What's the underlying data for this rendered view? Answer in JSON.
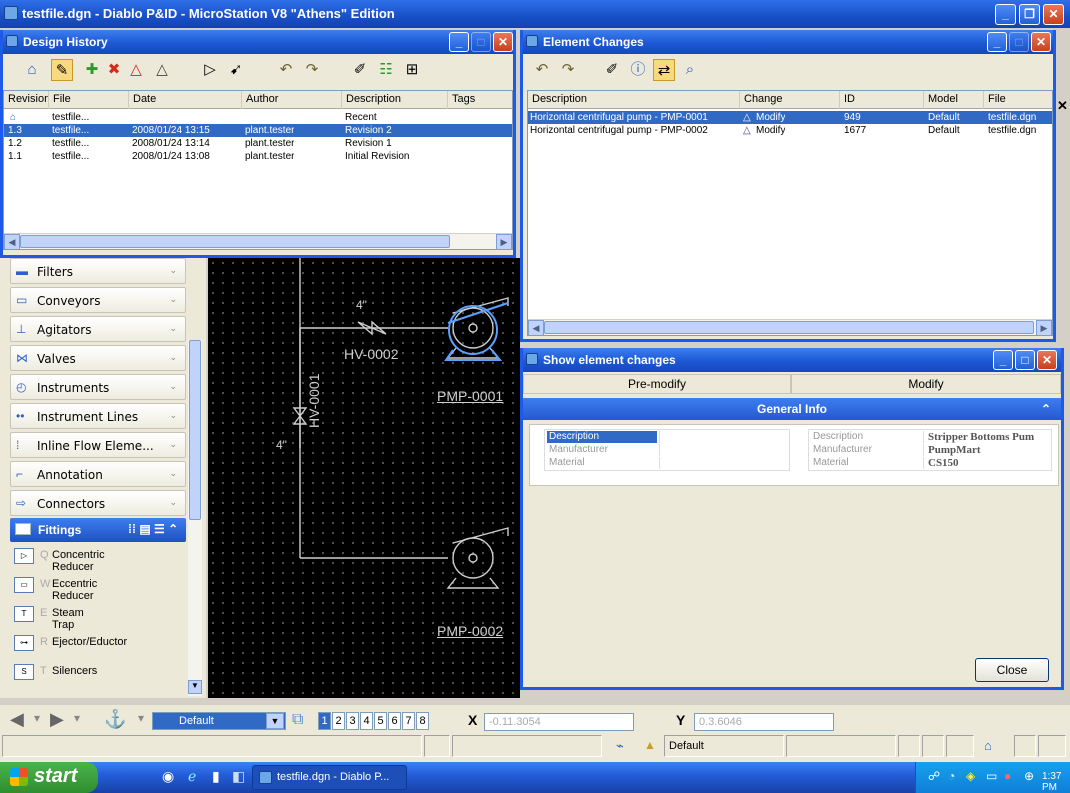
{
  "app": {
    "title": "testfile.dgn - Diablo P&ID - MicroStation V8 \"Athens\" Edition"
  },
  "design_history": {
    "title": "Design History",
    "columns": [
      "Revision",
      "File",
      "Date",
      "Author",
      "Description",
      "Tags"
    ],
    "rows": [
      {
        "revision": "",
        "file": "testfile...",
        "date": "",
        "author": "",
        "description": "Recent",
        "tags": ""
      },
      {
        "revision": "1.3",
        "file": "testfile...",
        "date": "2008/01/24 13:15",
        "author": "plant.tester",
        "description": "Revision 2",
        "tags": ""
      },
      {
        "revision": "1.2",
        "file": "testfile...",
        "date": "2008/01/24 13:14",
        "author": "plant.tester",
        "description": "Revision 1",
        "tags": ""
      },
      {
        "revision": "1.1",
        "file": "testfile...",
        "date": "2008/01/24 13:08",
        "author": "plant.tester",
        "description": "Initial Revision",
        "tags": ""
      }
    ]
  },
  "element_changes": {
    "title": "Element Changes",
    "columns": [
      "Description",
      "Change",
      "ID",
      "Model",
      "File"
    ],
    "rows": [
      {
        "description": "Horizontal centrifugal pump - PMP-0001",
        "change": "Modify",
        "id": "949",
        "model": "Default",
        "file": "testfile.dgn"
      },
      {
        "description": "Horizontal centrifugal pump - PMP-0002",
        "change": "Modify",
        "id": "1677",
        "model": "Default",
        "file": "testfile.dgn"
      }
    ]
  },
  "show_changes": {
    "title": "Show element changes",
    "pre_modify": "Pre-modify",
    "modify": "Modify",
    "section": "General Info",
    "left": [
      {
        "k": "Description",
        "v": ""
      },
      {
        "k": "Manufacturer",
        "v": ""
      },
      {
        "k": "Material",
        "v": ""
      }
    ],
    "right": [
      {
        "k": "Description",
        "v": "Stripper Bottoms Pum"
      },
      {
        "k": "Manufacturer",
        "v": "PumpMart"
      },
      {
        "k": "Material",
        "v": "CS150"
      }
    ],
    "close": "Close"
  },
  "palette": {
    "groups": [
      "Filters",
      "Conveyors",
      "Agitators",
      "Valves",
      "Instruments",
      "Instrument Lines",
      "Inline Flow Eleme...",
      "Annotation",
      "Connectors"
    ],
    "fittings_title": "Fittings",
    "fittings": [
      {
        "key": "Q",
        "name": "Concentric Reducer"
      },
      {
        "key": "W",
        "name": "Eccentric Reducer"
      },
      {
        "key": "E",
        "name": "Steam Trap"
      },
      {
        "key": "R",
        "name": "Ejector/Eductor"
      },
      {
        "key": "T",
        "name": "Silencers"
      }
    ]
  },
  "drawing": {
    "pipe_size_1": "4\"",
    "valve_1": "HV-0002",
    "pump_1": "PMP-0001",
    "pipe_size_2": "4\"",
    "valve_2": "HV-0001",
    "pump_2": "PMP-0002"
  },
  "bottom": {
    "level": "Default",
    "views": [
      "1",
      "2",
      "3",
      "4",
      "5",
      "6",
      "7",
      "8"
    ],
    "x_label": "X",
    "x_value": "-0.11.3054",
    "y_label": "Y",
    "y_value": "0.3.6046",
    "model": "Default"
  },
  "taskbar": {
    "start": "start",
    "task": "testfile.dgn - Diablo P...",
    "clock": "1:37 PM"
  },
  "colors": {
    "xp_blue": "#1d5ae8",
    "selection": "#316ac5",
    "canvas": "#000000"
  }
}
